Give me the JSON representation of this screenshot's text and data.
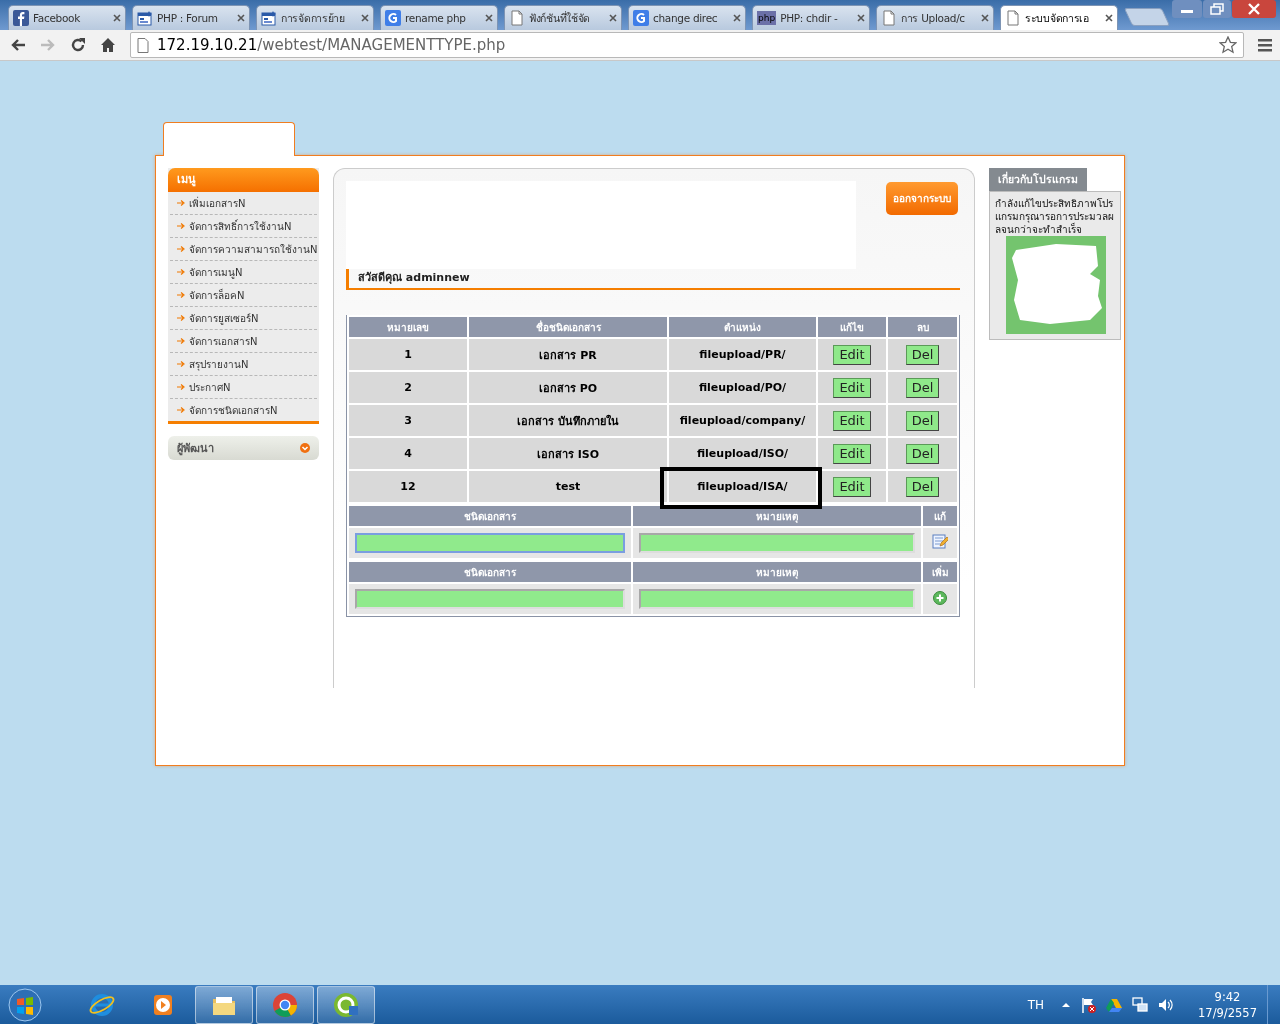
{
  "browser": {
    "tabs": [
      {
        "title": "Facebook",
        "selected": false
      },
      {
        "title": "PHP : Forum",
        "selected": false
      },
      {
        "title": "การจัดการย้าย",
        "selected": false
      },
      {
        "title": "rename php",
        "selected": false
      },
      {
        "title": "ฟังก์ชันที่ใช้จัด",
        "selected": false
      },
      {
        "title": "change direc",
        "selected": false
      },
      {
        "title": "PHP: chdir -",
        "icon_text": "php",
        "selected": false
      },
      {
        "title": "การ Upload/c",
        "selected": false
      },
      {
        "title": "ระบบจัดการเอ",
        "selected": true
      }
    ],
    "url": {
      "host": "172.19.10.21",
      "path": "/webtest/MANAGEMENTTYPE.php"
    }
  },
  "sidebar": {
    "menu_title": "เมนู",
    "items": [
      "เพิ่มเอกสารN",
      "จัดการสิทธิ์การใช้งานN",
      "จัดการความสามารถใช้งานN",
      "จัดการเมนูN",
      "จัดการล็อคN",
      "จัดการยูสเซอร์N",
      "จัดการเอกสารN",
      "สรุปรายงานN",
      "ประกาศN",
      "จัดการชนิดเอกสารN"
    ],
    "developer": {
      "label": "ผู้พัฒนา",
      "expanded": false
    }
  },
  "header": {
    "logout_button": "ออกจากระบบ",
    "greeting": "สวัสดีคุณ adminnew"
  },
  "table": {
    "columns": [
      "หมายเลข",
      "ชื่อชนิดเอกสาร",
      "ตำแหน่ง",
      "แก้ไข",
      "ลบ"
    ],
    "rows": [
      {
        "number": "1",
        "name": "เอกสาร PR",
        "path": "fileupload/PR/",
        "edit": "Edit",
        "delete": "Del",
        "highlighted": false
      },
      {
        "number": "2",
        "name": "เอกสาร PO",
        "path": "fileupload/PO/",
        "edit": "Edit",
        "delete": "Del",
        "highlighted": false
      },
      {
        "number": "3",
        "name": "เอกสาร บันทึกภายใน",
        "path": "fileupload/company/",
        "edit": "Edit",
        "delete": "Del",
        "highlighted": false
      },
      {
        "number": "4",
        "name": "เอกสาร ISO",
        "path": "fileupload/ISO/",
        "edit": "Edit",
        "delete": "Del",
        "highlighted": false
      },
      {
        "number": "12",
        "name": "test",
        "path": "fileupload/ISA/",
        "edit": "Edit",
        "delete": "Del",
        "highlighted": true
      }
    ]
  },
  "forms": [
    {
      "kind": "edit",
      "columns": [
        "ชนิดเอกสาร",
        "หมายเหตุ",
        "แก้"
      ],
      "fields": [
        {
          "focused": true
        },
        {
          "focused": false
        }
      ]
    },
    {
      "kind": "add",
      "columns": [
        "ชนิดเอกสาร",
        "หมายเหตุ",
        "เพิ่ม"
      ],
      "fields": [
        {
          "focused": false
        },
        {
          "focused": false
        }
      ]
    }
  ],
  "about": {
    "title": "เกี่ยวกับโปรแกรม",
    "text": "กำลังแก้ไขประสิทธิภาพโปรแกรมกรุณารอการประมวลผลจนกว่าจะทำสำเร็จ"
  },
  "taskbar": {
    "apps": [
      {
        "active": false
      },
      {
        "active": false
      },
      {
        "active": true
      },
      {
        "active": true
      },
      {
        "active": true
      }
    ],
    "language": "TH",
    "time": "9:42",
    "date": "17/9/2557"
  }
}
